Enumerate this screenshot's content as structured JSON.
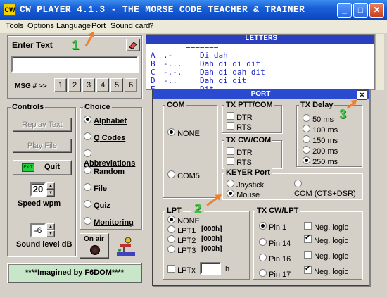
{
  "window": {
    "title": "CW_PLAYER 4.1.3 - THE MORSE CODE TEACHER & TRAINER",
    "app_icon": "CW",
    "minimize": "_",
    "maximize": "□",
    "close": "✕"
  },
  "menu": [
    "Tools",
    "Options",
    "Language",
    "Port",
    "Sound card",
    "?"
  ],
  "enter_text": {
    "title": "Enter Text",
    "value": "",
    "msg_label": "MSG # >>",
    "msg_buttons": [
      "1",
      "2",
      "3",
      "4",
      "5",
      "6"
    ]
  },
  "controls": {
    "title": "Controls",
    "replay_text": "Replay Text",
    "play_file": "Play File",
    "quit": "Quit",
    "quit_icon_text": "EXIT",
    "speed_value": "20",
    "speed_label": "Speed   wpm",
    "sound_value": "-6",
    "sound_label": "Sound level dB"
  },
  "choice": {
    "title": "Choice",
    "options": [
      "Alphabet",
      "Q Codes",
      "Abbreviations",
      "Random",
      "File",
      "Quiz",
      "Monitoring"
    ],
    "selected": "Alphabet"
  },
  "on_air": "On air",
  "footer": "****Imagined by F6DOM****",
  "letters": {
    "title": "LETTERS",
    "underline": "=======",
    "rows": [
      {
        "letter": "A",
        "code": ".-",
        "spoken": "Di dah"
      },
      {
        "letter": "B",
        "code": "-...",
        "spoken": "Dah di di dit"
      },
      {
        "letter": "C",
        "code": "-.-.",
        "spoken": "Dah di dah dit"
      },
      {
        "letter": "D",
        "code": "-..",
        "spoken": "Dah di dit"
      },
      {
        "letter": "E",
        "code": ".",
        "spoken": "Dit"
      }
    ]
  },
  "port": {
    "title": "PORT",
    "close": "×",
    "com": {
      "title": "COM",
      "options": [
        "NONE",
        "COM5"
      ],
      "selected": "NONE"
    },
    "tx_ptt_com": {
      "title": "TX PTT/COM",
      "options": [
        "DTR",
        "RTS"
      ]
    },
    "tx_cw_com": {
      "title": "TX CW/COM",
      "options": [
        "DTR",
        "RTS"
      ]
    },
    "tx_delay": {
      "title": "TX Delay",
      "options": [
        "50 ms",
        "100 ms",
        "150 ms",
        "200 ms",
        "250 ms"
      ],
      "selected": "250 ms"
    },
    "keyer": {
      "title": "KEYER Port",
      "options": [
        "Joystick",
        "COM (CTS+DSR)",
        "Mouse"
      ],
      "selected": "Mouse"
    },
    "lpt": {
      "title": "LPT",
      "options": [
        {
          "label": "NONE",
          "addr": ""
        },
        {
          "label": "LPT1",
          "addr": "[000h]"
        },
        {
          "label": "LPT2",
          "addr": "[000h]"
        },
        {
          "label": "LPT3",
          "addr": "[000h]"
        }
      ],
      "selected": "NONE",
      "lptx_label": "LPTx",
      "lptx_value": "",
      "lptx_suffix": "h"
    },
    "tx_cw_lpt": {
      "title": "TX CW/LPT",
      "pins": [
        {
          "label": "Pin 1",
          "selected": true,
          "neg": false
        },
        {
          "label": "Pin 14",
          "selected": false,
          "neg": true
        },
        {
          "label": "Pin 16",
          "selected": false,
          "neg": false
        },
        {
          "label": "Pin 17",
          "selected": false,
          "neg": true
        }
      ],
      "neg_label": "Neg. logic"
    }
  },
  "badges": [
    "1",
    "2",
    "3"
  ],
  "colors": {
    "accent": "#2a3fc0",
    "badge": "#3cc040",
    "arrow": "#f08030"
  }
}
